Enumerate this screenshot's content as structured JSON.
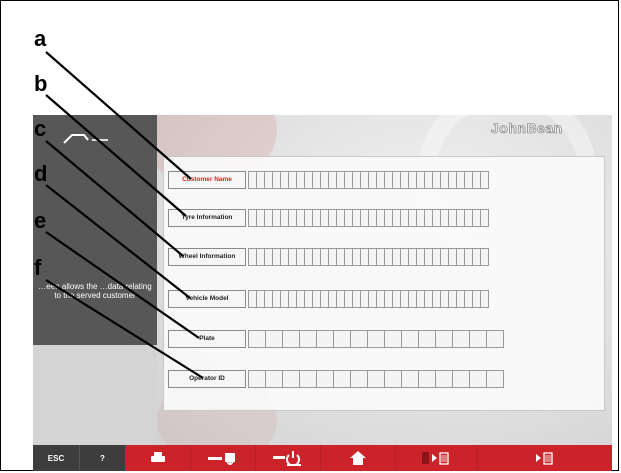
{
  "app": {
    "brand": "JohnBean"
  },
  "sidebar": {
    "description": "…een allows the …data relating to the served customer"
  },
  "fields": [
    {
      "label": "Customer Name",
      "cells": 30
    },
    {
      "label": "Tyre Information",
      "cells": 30
    },
    {
      "label": "Wheel Information",
      "cells": 30
    },
    {
      "label": "Vehicle Model",
      "cells": 30
    },
    {
      "label": "Plate",
      "cells": 15
    },
    {
      "label": "Operator ID",
      "cells": 15
    }
  ],
  "callouts": [
    "a",
    "b",
    "c",
    "d",
    "e",
    "f"
  ],
  "toolbar": {
    "esc_label": "ESC",
    "help_label": "?",
    "buttons": [
      "print-icon",
      "save-icon",
      "reset-icon",
      "home-icon",
      "delete-play-icon",
      "delete-next-icon"
    ]
  },
  "colors": {
    "accent": "#cc2229",
    "panel": "#575757",
    "label_red": "#dd2222"
  }
}
